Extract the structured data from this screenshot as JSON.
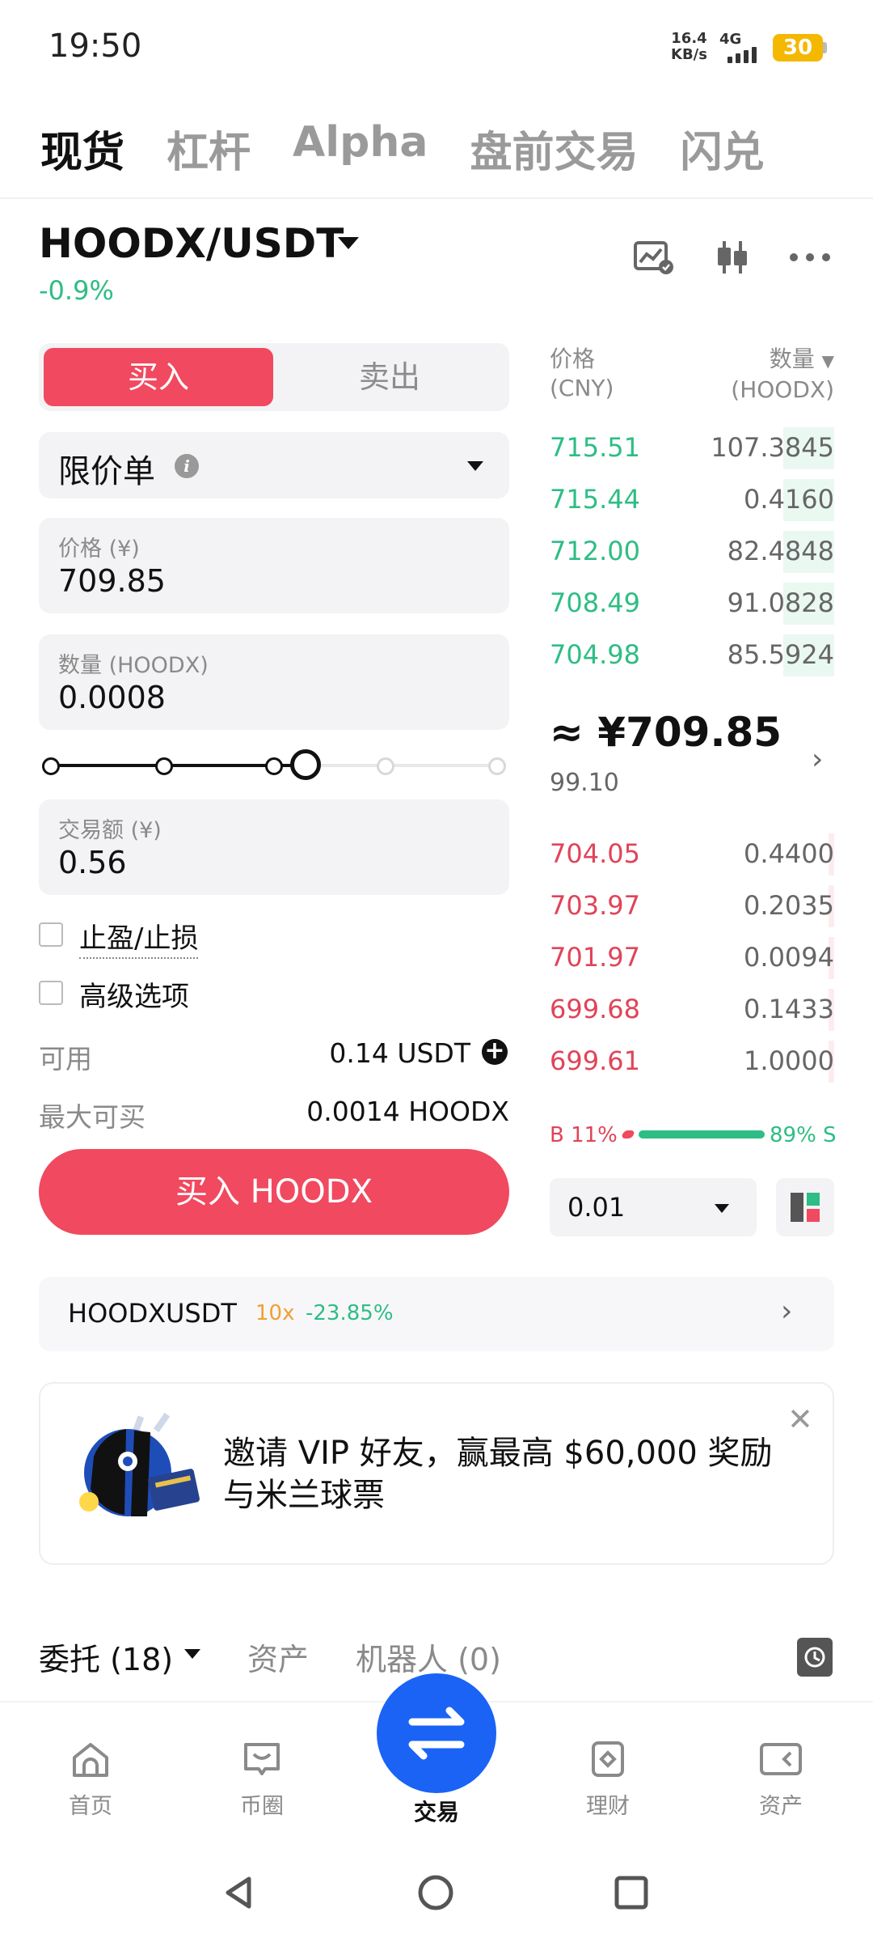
{
  "status_bar": {
    "time": "19:50",
    "net_speed": "16.4",
    "net_unit": "KB/s",
    "network": "4G",
    "battery": "30"
  },
  "top_tabs": [
    "现货",
    "杠杆",
    "Alpha",
    "盘前交易",
    "闪兑"
  ],
  "pair": {
    "symbol": "HOODX/USDT",
    "change": "-0.9%"
  },
  "order_form": {
    "buy_label": "买入",
    "sell_label": "卖出",
    "order_type": "限价单",
    "price_label": "价格 (¥)",
    "price_value": "709.85",
    "qty_label": "数量 (HOODX)",
    "qty_value": "0.0008",
    "slider_percent": 57,
    "total_label": "交易额 (¥)",
    "total_value": "0.56",
    "tp_sl_label": "止盈/止损",
    "advanced_label": "高级选项",
    "available_label": "可用",
    "available_value": "0.14 USDT",
    "max_buy_label": "最大可买",
    "max_buy_value": "0.0014 HOODX",
    "submit_label": "买入 HOODX"
  },
  "order_book": {
    "price_header": "价格",
    "price_unit": "(CNY)",
    "qty_header": "数量",
    "qty_unit": "(HOODX)",
    "asks": [
      {
        "price": "715.51",
        "qty": "107.3845",
        "depth": 0.18
      },
      {
        "price": "715.44",
        "qty": "0.4160",
        "depth": 0.18
      },
      {
        "price": "712.00",
        "qty": "82.4848",
        "depth": 0.18
      },
      {
        "price": "708.49",
        "qty": "91.0828",
        "depth": 0.18
      },
      {
        "price": "704.98",
        "qty": "85.5924",
        "depth": 0.18
      }
    ],
    "mid_price": "≈ ¥709.85",
    "mid_sub": "99.10",
    "bids": [
      {
        "price": "704.05",
        "qty": "0.4400",
        "depth": 0.02
      },
      {
        "price": "703.97",
        "qty": "0.2035",
        "depth": 0.02
      },
      {
        "price": "701.97",
        "qty": "0.0094",
        "depth": 0.02
      },
      {
        "price": "699.68",
        "qty": "0.1433",
        "depth": 0.02
      },
      {
        "price": "699.61",
        "qty": "1.0000",
        "depth": 0.02
      }
    ],
    "buy_ratio": "B 11%",
    "sell_ratio": "89% S",
    "depth_step": "0.01"
  },
  "futures": {
    "symbol": "HOODXUSDT",
    "leverage": "10x",
    "change": "-23.85%"
  },
  "promo": {
    "text": "邀请 VIP 好友，赢最高 $60,000 奖励与米兰球票"
  },
  "orders_tabs": {
    "orders": "委托 (18)",
    "assets": "资产",
    "bots": "机器人 (0)"
  },
  "bottom_nav": [
    "首页",
    "币圈",
    "交易",
    "理财",
    "资产"
  ],
  "colors": {
    "buy": "#f1495f",
    "up": "#2ebd85",
    "down": "#e04458",
    "trade": "#1a63f5"
  }
}
